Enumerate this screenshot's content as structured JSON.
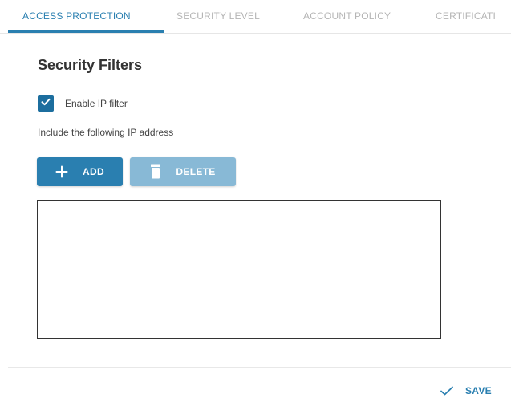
{
  "tabs": [
    {
      "label": "ACCESS PROTECTION",
      "active": true
    },
    {
      "label": "SECURITY LEVEL",
      "active": false
    },
    {
      "label": "ACCOUNT POLICY",
      "active": false
    },
    {
      "label": "CERTIFICATI",
      "active": false
    }
  ],
  "section": {
    "title": "Security Filters"
  },
  "ip_filter": {
    "checkbox_label": "Enable IP filter",
    "checked": true,
    "include_text": "Include the following IP address",
    "entries": []
  },
  "buttons": {
    "add_label": "ADD",
    "delete_label": "DELETE",
    "save_label": "SAVE"
  },
  "icons": {
    "checkbox": "checkmark-icon",
    "add": "plus-icon",
    "delete": "trash-icon",
    "save": "checkmark-icon"
  },
  "colors": {
    "accent": "#2a7fb0",
    "checkbox": "#1c6e9e",
    "delete_disabled": "#88b9d6",
    "inactive_tab": "#b5b5b5"
  }
}
